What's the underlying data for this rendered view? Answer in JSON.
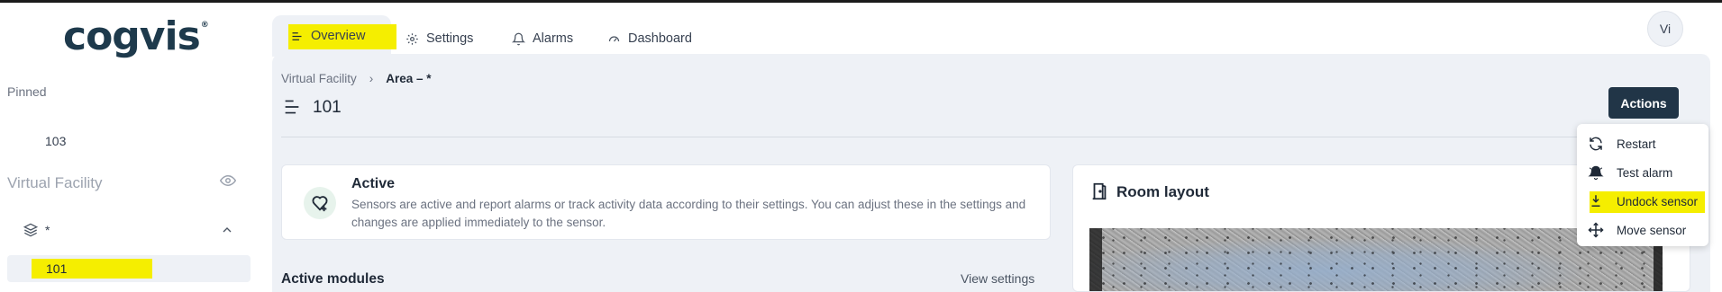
{
  "brand": {
    "name": "cogvis",
    "reg_mark": "®"
  },
  "sidebar": {
    "pinned_label": "Pinned",
    "pinned_items": [
      "103"
    ],
    "facility_label": "Virtual Facility",
    "group_label": "*",
    "selected_item": "101"
  },
  "tabs": [
    {
      "label": "Overview",
      "icon": "menu-lines-icon",
      "active": true
    },
    {
      "label": "Settings",
      "icon": "gear-icon"
    },
    {
      "label": "Alarms",
      "icon": "bell-icon"
    },
    {
      "label": "Dashboard",
      "icon": "gauge-icon"
    }
  ],
  "user": {
    "initials": "Vi"
  },
  "breadcrumb": {
    "root": "Virtual Facility",
    "separator": "›",
    "current": "Area – *"
  },
  "page": {
    "title": "101"
  },
  "actions": {
    "button_label": "Actions",
    "menu": [
      {
        "label": "Restart",
        "icon": "refresh-icon"
      },
      {
        "label": "Test alarm",
        "icon": "alarm-bell-icon"
      },
      {
        "label": "Undock sensor",
        "icon": "undock-icon",
        "highlighted": true
      },
      {
        "label": "Move sensor",
        "icon": "move-icon"
      }
    ]
  },
  "status": {
    "title": "Active",
    "description": "Sensors are active and report alarms or track activity data according to their settings. You can adjust these in the settings and changes are applied immediately to the sensor.",
    "icon": "heart-plus-icon"
  },
  "modules": {
    "title": "Active modules",
    "link": "View settings"
  },
  "room": {
    "title": "Room layout",
    "icon": "door-icon"
  },
  "colors": {
    "accent": "#213547",
    "highlight": "#f5ee00",
    "panel": "#eef1f6"
  }
}
